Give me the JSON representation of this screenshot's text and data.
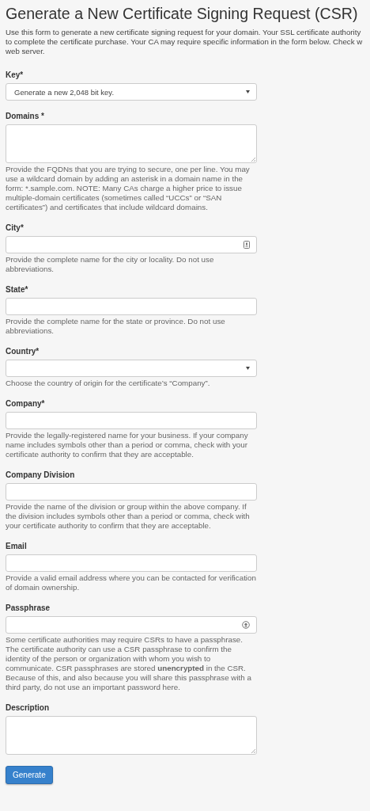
{
  "title": "Generate a New Certificate Signing Request (CSR)",
  "intro_lines": [
    "Use this form to generate a new certificate signing request for your domain. Your SSL certificate authority",
    "to complete the certificate purchase. Your CA may require specific information in the form below. Check w",
    "web server."
  ],
  "fields": [
    {
      "kind": "select",
      "label": "Key*",
      "value": "Generate a new 2,048 bit key."
    },
    {
      "kind": "textarea",
      "label": "Domains *",
      "help": "Provide the FQDNs that you are trying to secure, one per line. You may use a wildcard domain by adding an asterisk in a domain name in the form: *.sample.com. NOTE: Many CAs charge a higher price to issue multiple-domain certificates (sometimes called “UCCs” or “SAN certificates”) and certificates that include wildcard domains."
    },
    {
      "kind": "text",
      "label": "City*",
      "help": "Provide the complete name for the city or locality. Do not use abbreviations."
    },
    {
      "kind": "text",
      "label": "State*",
      "help": "Provide the complete name for the state or province. Do not use abbreviations."
    },
    {
      "kind": "select",
      "label": "Country*",
      "help": "Choose the country of origin for the certificate’s “Company”."
    },
    {
      "kind": "text",
      "label": "Company*",
      "help": "Provide the legally-registered name for your business. If your company name includes symbols other than a period or comma, check with your certificate authority to confirm that they are acceptable."
    },
    {
      "kind": "text",
      "label": "Company Division",
      "help": "Provide the name of the division or group within the above company. If the division includes symbols other than a period or comma, check with your certificate authority to confirm that they are acceptable."
    },
    {
      "kind": "text",
      "label": "Email",
      "help": "Provide a valid email address where you can be contacted for verification of domain ownership."
    },
    {
      "kind": "text",
      "label": "Passphrase",
      "help": "Some certificate authorities may require CSRs to have a passphrase. The certificate authority can use a CSR passphrase to confirm the identity of the person or organization with whom you wish to communicate. CSR passphrases are stored **unencrypted** in the CSR. Because of this, and also because you will share this passphrase with a third party, do not use an important password here."
    },
    {
      "kind": "textarea",
      "label": "Description"
    }
  ],
  "button": "Generate"
}
